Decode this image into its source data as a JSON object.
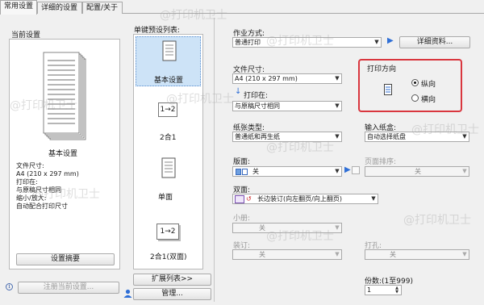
{
  "tabs": [
    "常用设置",
    "详细的设置",
    "配置/关于"
  ],
  "current_settings": {
    "heading": "当前设置",
    "preview_title": "基本设置",
    "summary_lines": [
      "文件尺寸:",
      "  A4 (210 x 297 mm)",
      "打印在:",
      "  与原稿尺寸相同",
      "缩小/放大:",
      "  自动配合打印尺寸"
    ],
    "settings_summary_button": "设置摘要",
    "register_button": "注册当前设置..."
  },
  "presets": {
    "heading": "单键预设列表:",
    "items": [
      {
        "label": "基本设置",
        "icon_text": ""
      },
      {
        "label": "2合1",
        "icon_text": "1→2"
      },
      {
        "label": "单面",
        "icon_text": ""
      },
      {
        "label": "2合1(双面)",
        "icon_text": "1→2"
      }
    ],
    "expand_button": "扩展列表>>",
    "manage_button": "管理..."
  },
  "job": {
    "label": "作业方式:",
    "value": "普通打印",
    "details_button": "详细资料..."
  },
  "paper_size": {
    "label": "文件尺寸:",
    "value": "A4 (210 x 297 mm)"
  },
  "print_on": {
    "label": "打印在:",
    "value": "与原稿尺寸相同"
  },
  "orientation": {
    "heading": "打印方向",
    "options": [
      "纵向",
      "横向"
    ],
    "selected": "纵向",
    "highlight_color": "#d9363e"
  },
  "media_type": {
    "label": "纸张类型:",
    "value": "普通纸和再生纸"
  },
  "paper_source": {
    "label": "输入纸盒:",
    "value": "自动选择纸盘"
  },
  "page_layout": {
    "label": "版面:",
    "value": "关"
  },
  "page_order": {
    "label": "页面排序:",
    "value": "关"
  },
  "duplex": {
    "label": "双面:",
    "value": "长边装订(向左翻页/向上翻页)"
  },
  "booklet": {
    "label": "小册:",
    "value": "关"
  },
  "binding": {
    "label": "装订:",
    "value": "关"
  },
  "punch": {
    "label": "打孔:",
    "value": "关"
  },
  "copies": {
    "label": "份数:(1至999)",
    "value": "1"
  },
  "watermark_text": "@打印机卫士",
  "colors": {
    "accent_blue": "#2f6fd6",
    "selection_bg": "#cde3f7"
  }
}
